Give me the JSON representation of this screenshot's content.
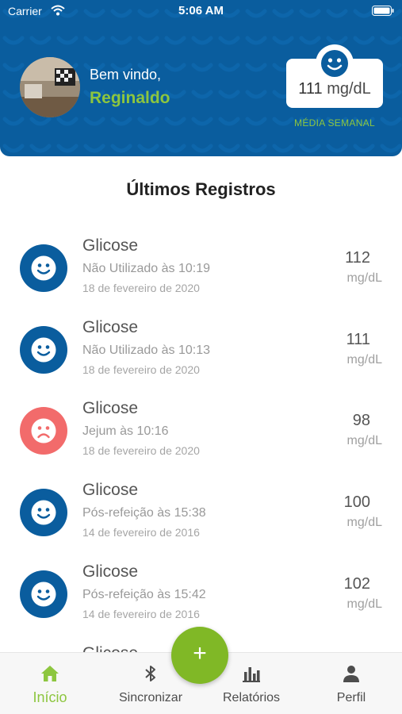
{
  "status_bar": {
    "carrier": "Carrier",
    "time": "5:06 AM",
    "icons": [
      "wifi-icon",
      "battery-icon"
    ]
  },
  "header": {
    "greeting": "Bem vindo,",
    "user_name": "Reginaldo",
    "weekly_average": {
      "value": "111",
      "unit": "mg/dL",
      "label": "MÉDIA SEMANAL",
      "icon": "happy-face-icon"
    }
  },
  "section_title": "Últimos Registros",
  "records": [
    {
      "title": "Glicose",
      "context": "Não Utilizado às 10:19",
      "date": "18 de fevereiro de 2020",
      "value": "112",
      "unit": "mg/dL",
      "mood": "happy"
    },
    {
      "title": "Glicose",
      "context": "Não Utilizado às 10:13",
      "date": "18 de fevereiro de 2020",
      "value": "111",
      "unit": "mg/dL",
      "mood": "happy"
    },
    {
      "title": "Glicose",
      "context": "Jejum às 10:16",
      "date": "18 de fevereiro de 2020",
      "value": "98",
      "unit": "mg/dL",
      "mood": "sad"
    },
    {
      "title": "Glicose",
      "context": "Pós-refeição às 15:38",
      "date": "14 de fevereiro de 2016",
      "value": "100",
      "unit": "mg/dL",
      "mood": "happy"
    },
    {
      "title": "Glicose",
      "context": "Pós-refeição às 15:42",
      "date": "14 de fevereiro de 2016",
      "value": "102",
      "unit": "mg/dL",
      "mood": "happy"
    },
    {
      "title": "Glicose",
      "context": "",
      "date": "",
      "value": "",
      "unit": "",
      "mood": "sad"
    }
  ],
  "fab": {
    "label": "+"
  },
  "tabs": [
    {
      "label": "Início",
      "icon": "home-icon",
      "active": true
    },
    {
      "label": "Sincronizar",
      "icon": "bluetooth-icon",
      "active": false
    },
    {
      "label": "Relatórios",
      "icon": "bar-chart-icon",
      "active": false
    },
    {
      "label": "Perfil",
      "icon": "person-icon",
      "active": false
    }
  ],
  "colors": {
    "primary": "#0a5d9e",
    "accent": "#8dc63f",
    "fab": "#80b826",
    "sad": "#f26b6b"
  }
}
